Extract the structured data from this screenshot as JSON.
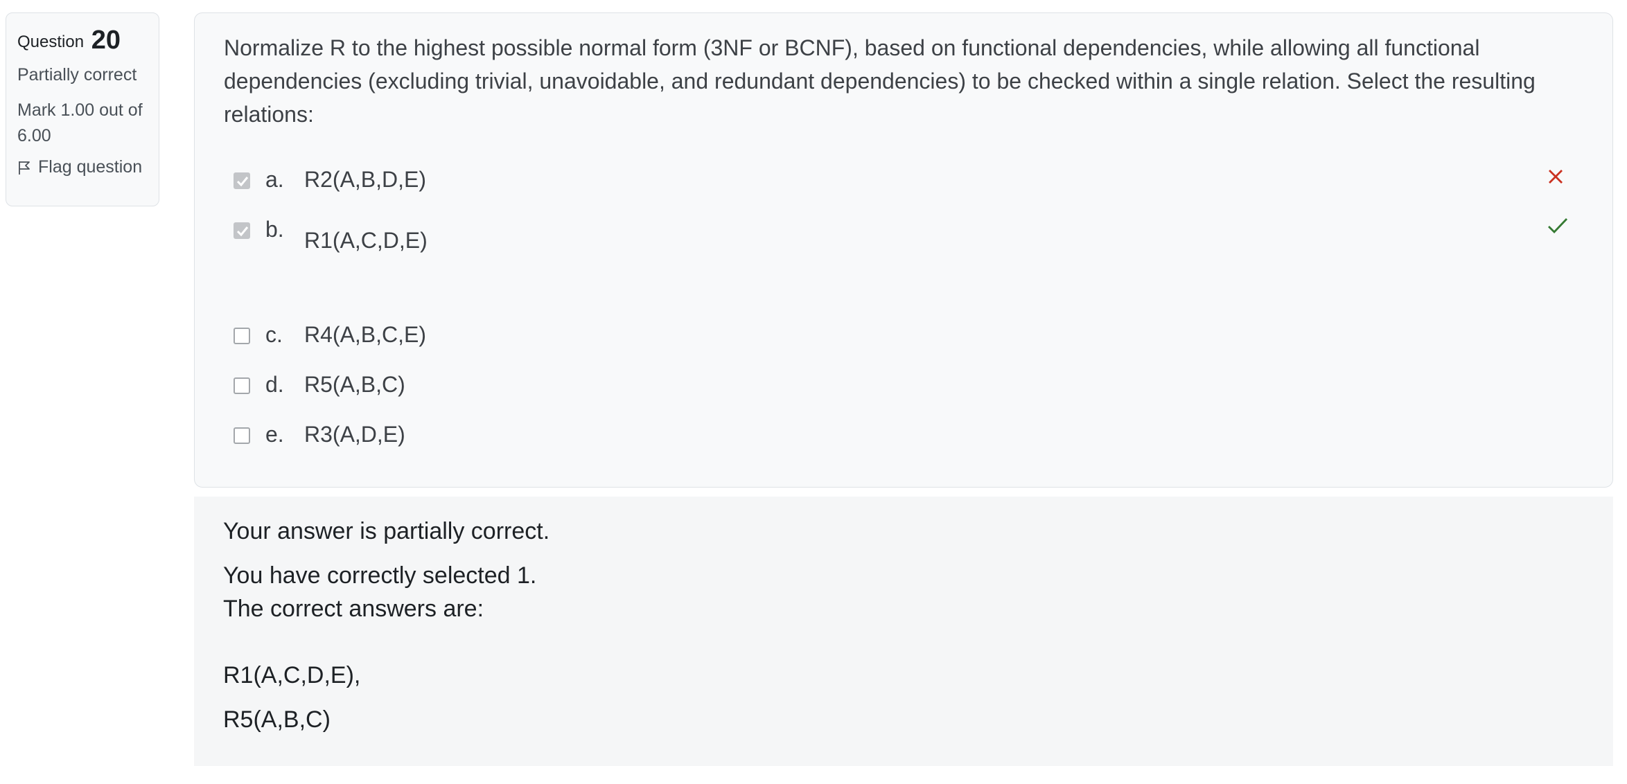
{
  "info": {
    "question_word": "Question",
    "question_number": "20",
    "state": "Partially correct",
    "grade": "Mark 1.00 out of 6.00",
    "flag_label": "Flag question"
  },
  "question": {
    "text": "Normalize R to the highest possible normal form (3NF or BCNF), based on functional dependencies, while allowing all functional dependencies (excluding trivial, unavoidable, and redundant dependencies) to be checked within a single relation. Select the resulting relations:",
    "options": [
      {
        "letter": "a.",
        "text": "R2(A,B,D,E)",
        "checked": true,
        "feedback": "incorrect"
      },
      {
        "letter": "b.",
        "text": "R1(A,C,D,E)",
        "checked": true,
        "feedback": "correct"
      },
      {
        "letter": "c.",
        "text": "R4(A,B,C,E)",
        "checked": false,
        "feedback": "none"
      },
      {
        "letter": "d.",
        "text": "R5(A,B,C)",
        "checked": false,
        "feedback": "none"
      },
      {
        "letter": "e.",
        "text": "R3(A,D,E)",
        "checked": false,
        "feedback": "none"
      }
    ]
  },
  "feedback": {
    "summary": "Your answer is partially correct.",
    "selected_count": "You have correctly selected 1.",
    "correct_intro": "The correct answers are:",
    "answers": [
      "R1(A,C,D,E),",
      "R5(A,B,C)"
    ]
  },
  "colors": {
    "incorrect": "#ca3120",
    "correct": "#357a32"
  }
}
